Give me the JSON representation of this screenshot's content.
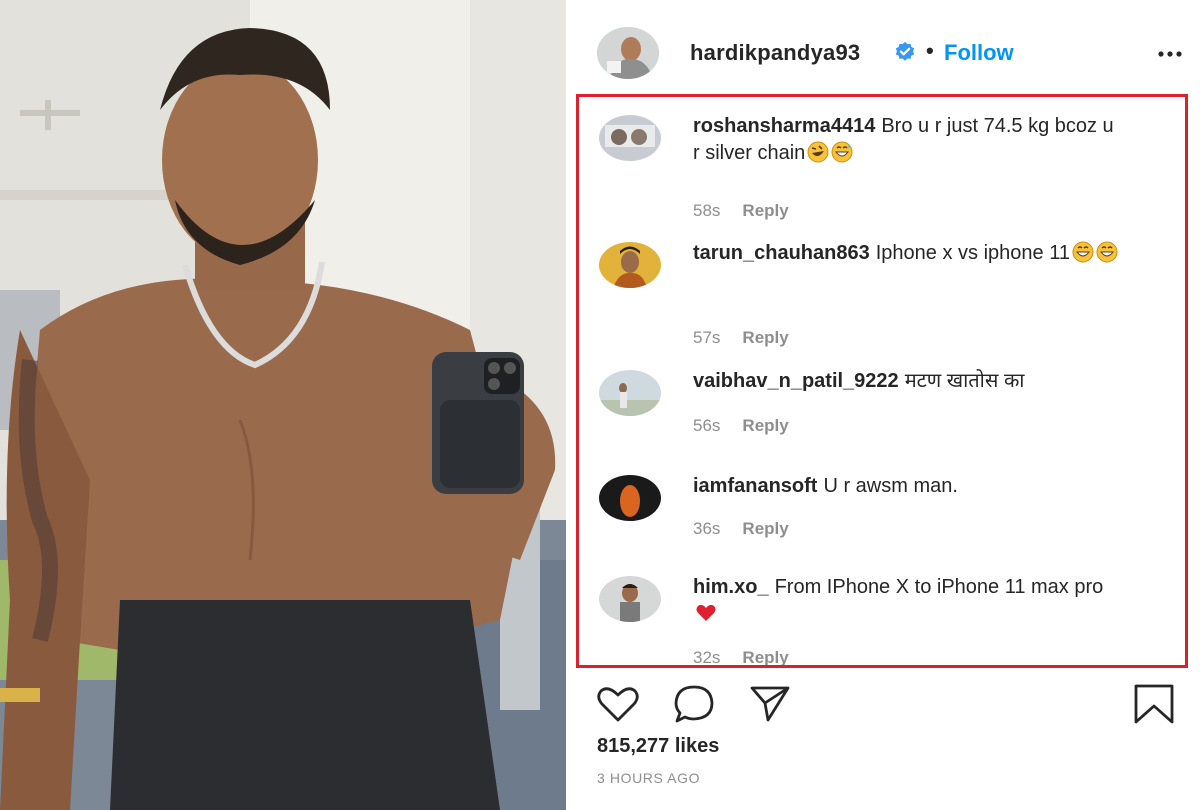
{
  "post": {
    "username": "hardikpandya93",
    "separator": "•",
    "follow_label": "Follow",
    "likes": "815,277 likes",
    "time_ago": "3 HOURS AGO"
  },
  "comments": [
    {
      "user": "roshansharma4414",
      "text": "Bro u r just 74.5 kg bcoz u r silver chain",
      "emojis": [
        "rofl-emoji",
        "grin-sweat-emoji"
      ],
      "time": "58s",
      "reply": "Reply"
    },
    {
      "user": "tarun_chauhan863",
      "text": "Iphone x vs iphone 11",
      "emojis": [
        "grin-emoji",
        "grin-emoji"
      ],
      "time": "57s",
      "reply": "Reply"
    },
    {
      "user": "vaibhav_n_patil_9222",
      "text": "मटण खातोस का",
      "emojis": [],
      "time": "56s",
      "reply": "Reply"
    },
    {
      "user": "iamfanansoft",
      "text": "U r awsm man.",
      "emojis": [],
      "time": "36s",
      "reply": "Reply"
    },
    {
      "user": "him.xo_",
      "text": "From IPhone X to iPhone 11 max pro",
      "emojis": [
        "red-heart-emoji"
      ],
      "time": "32s",
      "reply": "Reply"
    }
  ],
  "icons": {
    "verified": "verified-badge-icon",
    "more": "more-options-icon",
    "like": "heart-icon",
    "comment": "comment-bubble-icon",
    "share": "paper-plane-icon",
    "save": "bookmark-icon"
  },
  "colors": {
    "follow": "#0095f6",
    "highlight_border": "#d9222a",
    "muted": "#8e8e8e",
    "text": "#262626"
  }
}
